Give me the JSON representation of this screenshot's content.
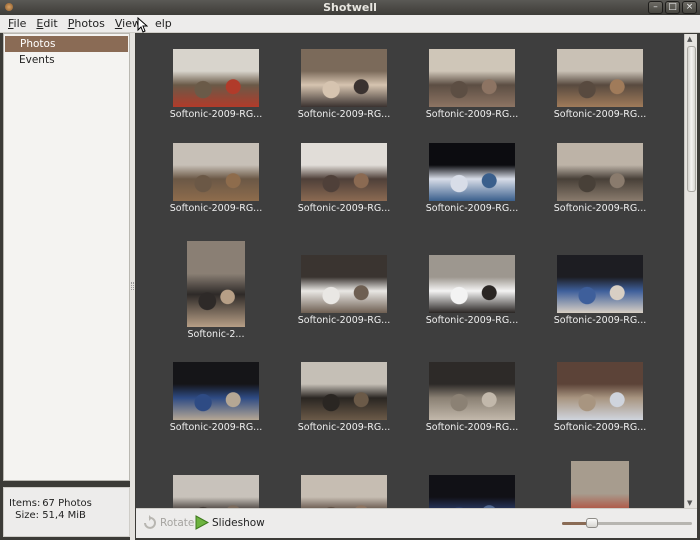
{
  "window": {
    "title": "Shotwell"
  },
  "menubar": [
    {
      "label": "File",
      "u": "F",
      "rest": "ile"
    },
    {
      "label": "Edit",
      "u": "E",
      "rest": "dit"
    },
    {
      "label": "Photos",
      "u": "P",
      "rest": "hotos"
    },
    {
      "label": "View",
      "u": "V",
      "rest": "iew"
    },
    {
      "label": "Help",
      "u": "",
      "rest": "elp"
    }
  ],
  "sidebar": {
    "items": [
      {
        "label": "Photos",
        "selected": true
      },
      {
        "label": "Events",
        "selected": false
      }
    ]
  },
  "status": {
    "items_label": "Items:",
    "items_value": "67 Photos",
    "size_label": "Size:",
    "size_value": "51,4 MiB"
  },
  "toolbar": {
    "rotate_label": "Rotate",
    "slideshow_label": "Slideshow",
    "zoom_level": 0.23
  },
  "photos": [
    {
      "caption": "Softonic-2009-RG...",
      "orient": "land",
      "palette": [
        "#d8d4cc",
        "#6a5a48",
        "#b13b2a"
      ]
    },
    {
      "caption": "Softonic-2009-RG...",
      "orient": "land",
      "palette": [
        "#7b6a5a",
        "#d6c4b0",
        "#3a3230"
      ]
    },
    {
      "caption": "Softonic-2009-RG...",
      "orient": "land",
      "palette": [
        "#cfc6b8",
        "#5c4e43",
        "#8d7463"
      ]
    },
    {
      "caption": "Softonic-2009-RG...",
      "orient": "land",
      "palette": [
        "#c9c1b5",
        "#584a3f",
        "#a07b5a"
      ]
    },
    {
      "caption": "Softonic-2009-RG...",
      "orient": "land",
      "palette": [
        "#c7c0b7",
        "#6b5846",
        "#8e6c4c"
      ]
    },
    {
      "caption": "Softonic-2009-RG...",
      "orient": "land",
      "palette": [
        "#e1ddd8",
        "#4f4039",
        "#8b6a52"
      ]
    },
    {
      "caption": "Softonic-2009-RG...",
      "orient": "land",
      "palette": [
        "#0c0c10",
        "#d8dde8",
        "#3a5f8c"
      ]
    },
    {
      "caption": "Softonic-2009-RG...",
      "orient": "land",
      "palette": [
        "#bdb3a7",
        "#484038",
        "#8a7b6d"
      ]
    },
    {
      "caption": "Softonic-2...",
      "orient": "port",
      "palette": [
        "#8a7f74",
        "#2e2a28",
        "#b79f86"
      ]
    },
    {
      "caption": "Softonic-2009-RG...",
      "orient": "land",
      "palette": [
        "#3a3430",
        "#e9e7e4",
        "#6e5f52"
      ]
    },
    {
      "caption": "Softonic-2009-RG...",
      "orient": "land",
      "palette": [
        "#9d978f",
        "#f3f3f3",
        "#2a2624"
      ]
    },
    {
      "caption": "Softonic-2009-RG...",
      "orient": "land",
      "palette": [
        "#1d1d22",
        "#3e5f9b",
        "#d8cfc4"
      ]
    },
    {
      "caption": "Softonic-2009-RG...",
      "orient": "land",
      "palette": [
        "#151518",
        "#2e4b84",
        "#b5a794"
      ]
    },
    {
      "caption": "Softonic-2009-RG...",
      "orient": "land",
      "palette": [
        "#c5bfb6",
        "#2a2622",
        "#6b5a48"
      ]
    },
    {
      "caption": "Softonic-2009-RG...",
      "orient": "land",
      "palette": [
        "#2d2a28",
        "#8b8174",
        "#c2b8ab"
      ]
    },
    {
      "caption": "Softonic-2009-RG...",
      "orient": "land",
      "palette": [
        "#5c4338",
        "#a89580",
        "#cfd4dd"
      ]
    },
    {
      "caption": "",
      "orient": "land",
      "palette": [
        "#c8c2bb",
        "#3f3834",
        "#7a6a5c"
      ]
    },
    {
      "caption": "",
      "orient": "land",
      "palette": [
        "#c6bdb2",
        "#5c4c41",
        "#8d7461"
      ]
    },
    {
      "caption": "",
      "orient": "land",
      "palette": [
        "#111116",
        "#2a3b66",
        "#546b94"
      ]
    },
    {
      "caption": "",
      "orient": "port",
      "palette": [
        "#a79c8e",
        "#b3402d",
        "#4f463f"
      ]
    }
  ]
}
